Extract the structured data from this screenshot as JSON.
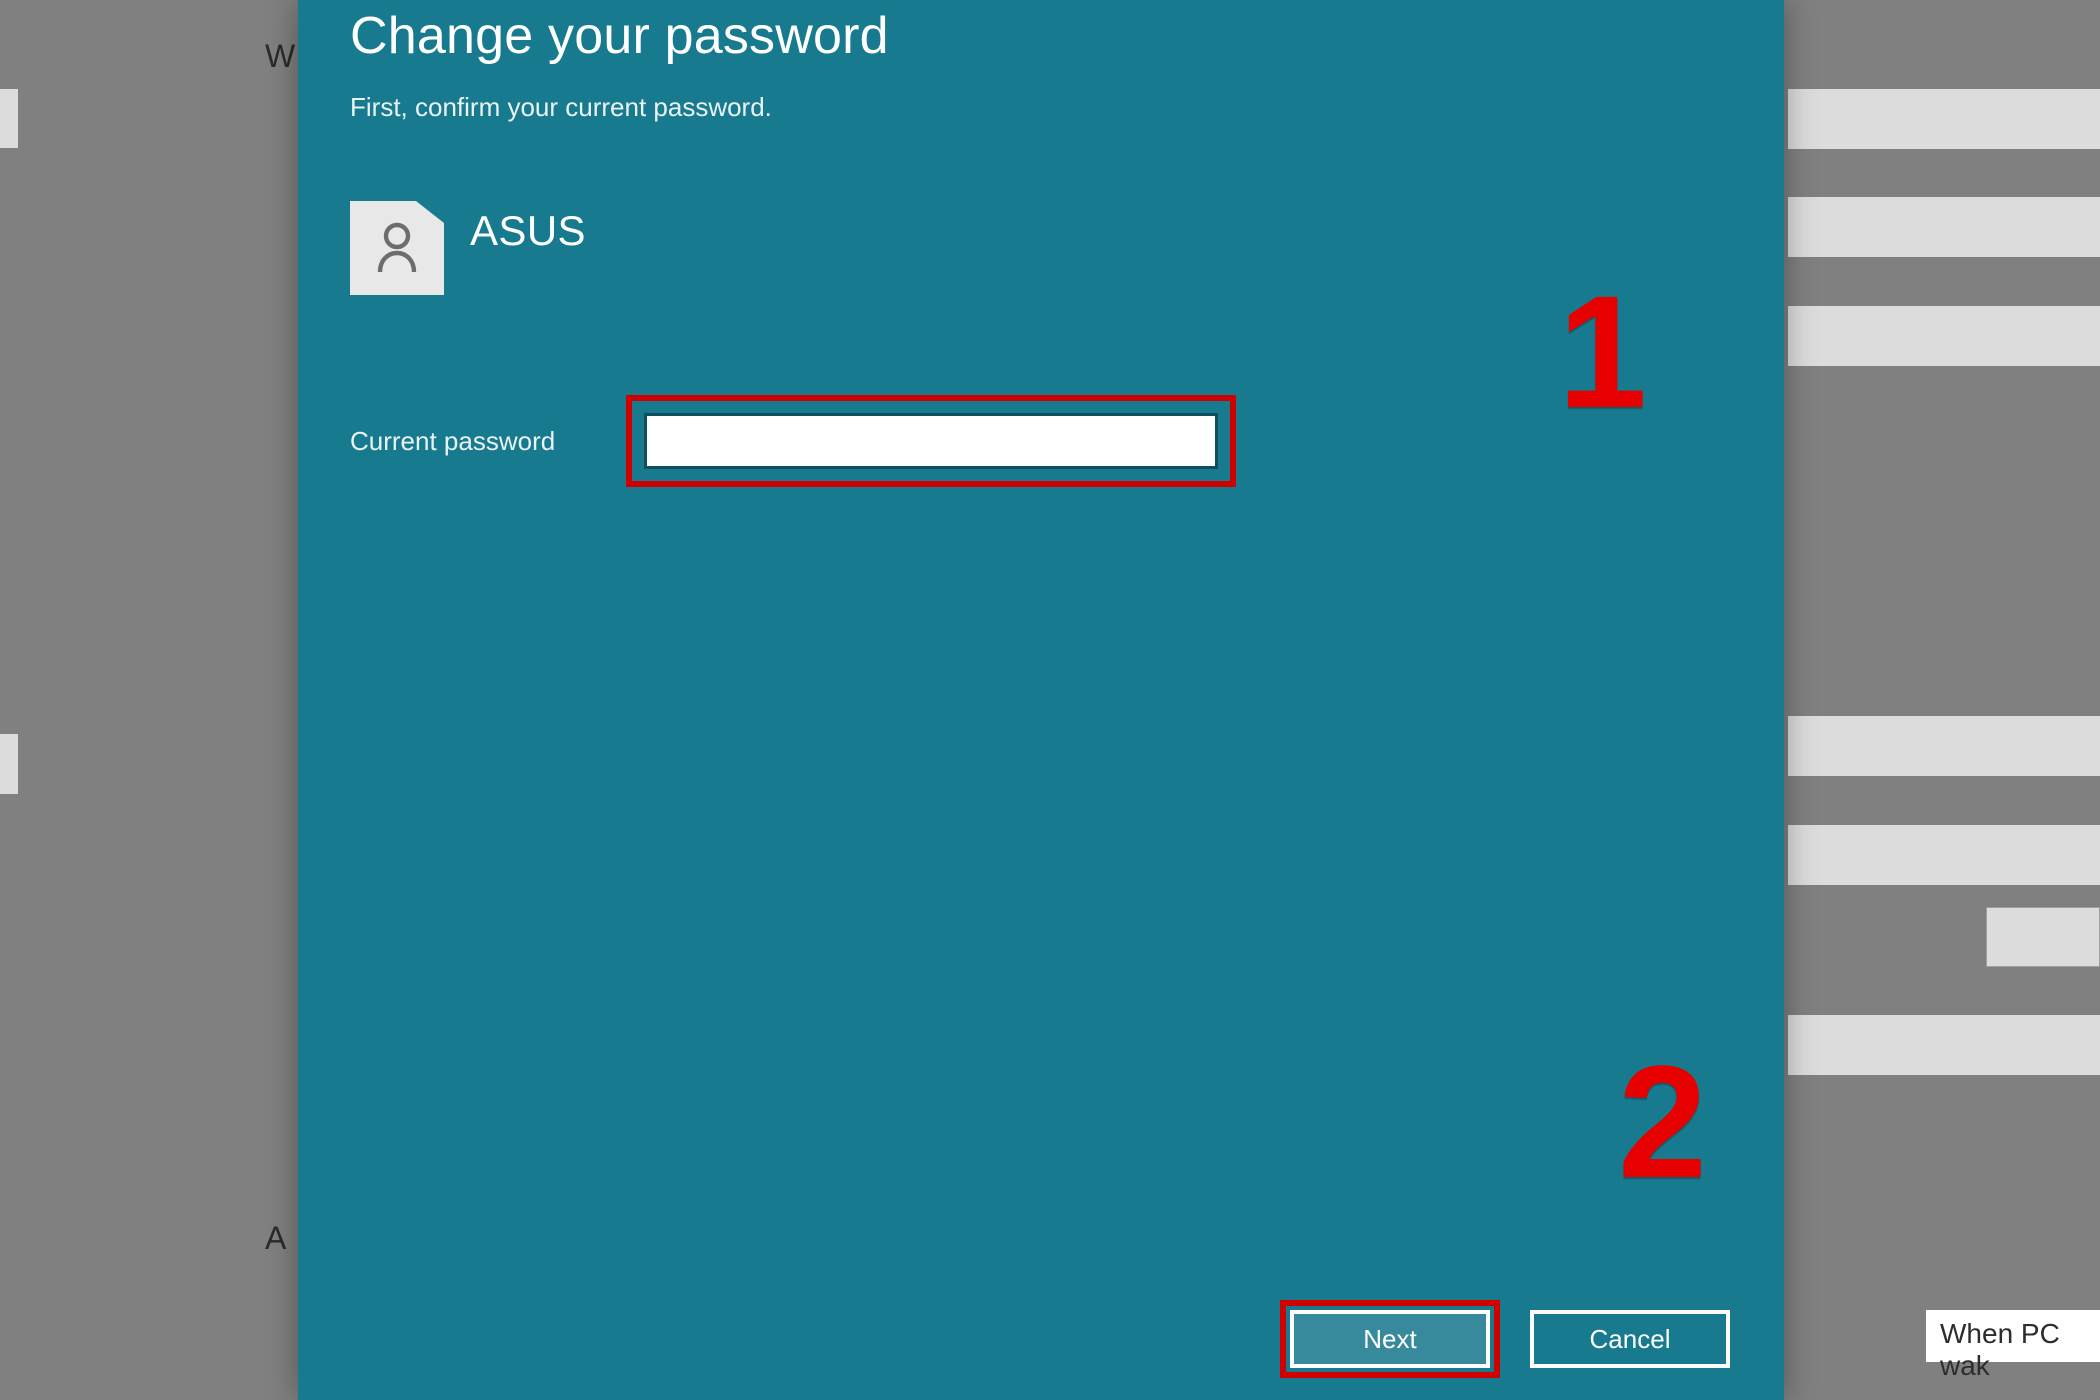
{
  "background": {
    "left_w": "W",
    "left_a": "A",
    "wake_label": "When PC wak"
  },
  "dialog": {
    "title": "Change your password",
    "subtitle": "First, confirm your current password.",
    "user": {
      "name": "ASUS",
      "avatar_icon": "person-icon"
    },
    "field": {
      "label": "Current password",
      "value": ""
    },
    "buttons": {
      "next": "Next",
      "cancel": "Cancel"
    }
  },
  "annotation": {
    "callout1": "1",
    "callout2": "2",
    "highlight_color": "#d10000"
  }
}
